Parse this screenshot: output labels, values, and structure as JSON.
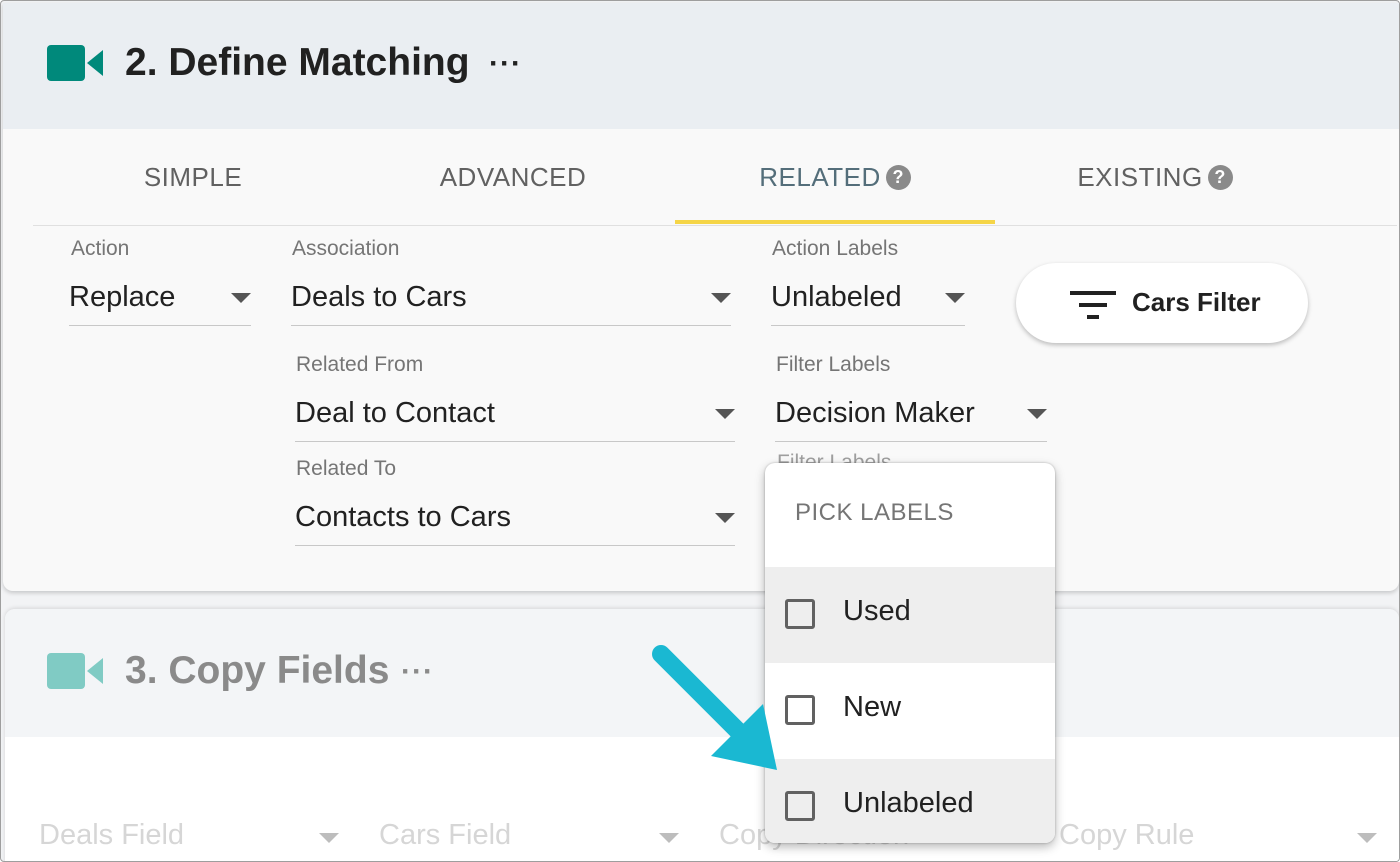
{
  "colors": {
    "accent_teal": "#00897b",
    "faded_teal": "#80cbc4",
    "tab_underline": "#f5d547",
    "arrow": "#1ab8d2"
  },
  "section2": {
    "icon": "video-camera-icon",
    "title": "2. Define Matching",
    "menu_glyph": "···",
    "tabs": [
      {
        "label": "SIMPLE",
        "help": false
      },
      {
        "label": "ADVANCED",
        "help": false
      },
      {
        "label": "RELATED",
        "help": true
      },
      {
        "label": "EXISTING",
        "help": true
      }
    ],
    "active_tab": "RELATED",
    "help_glyph": "?",
    "fields": {
      "action": {
        "label": "Action",
        "value": "Replace"
      },
      "association": {
        "label": "Association",
        "value": "Deals to Cars"
      },
      "action_labels": {
        "label": "Action Labels",
        "value": "Unlabeled"
      },
      "related_from": {
        "label": "Related From",
        "value": "Deal to Contact"
      },
      "filter_labels": {
        "label": "Filter Labels",
        "value": "Decision Maker"
      },
      "related_to": {
        "label": "Related To",
        "value": "Contacts to Cars"
      },
      "hidden_label": "Filter Labels"
    },
    "filter_button": {
      "icon": "filter-icon",
      "label": "Cars Filter"
    }
  },
  "section3": {
    "icon": "video-camera-icon",
    "title": "3. Copy Fields",
    "menu_glyph": "···",
    "columns": [
      "Deals Field",
      "Cars Field",
      "Copy Direction",
      "Copy Rule"
    ]
  },
  "dropdown": {
    "header": "PICK LABELS",
    "options": [
      {
        "label": "Used",
        "checked": false,
        "highlighted": true
      },
      {
        "label": "New",
        "checked": false,
        "highlighted": false
      },
      {
        "label": "Unlabeled",
        "checked": false,
        "highlighted": true
      }
    ]
  }
}
